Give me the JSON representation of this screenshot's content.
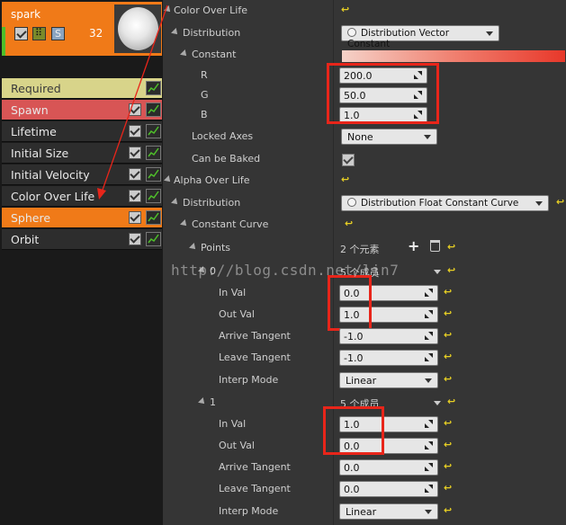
{
  "emitter": {
    "name": "spark",
    "solo": "S",
    "count": "32"
  },
  "modules": [
    {
      "label": "Required"
    },
    {
      "label": "Spawn"
    },
    {
      "label": "Lifetime"
    },
    {
      "label": "Initial Size"
    },
    {
      "label": "Initial Velocity"
    },
    {
      "label": "Color Over Life"
    },
    {
      "label": "Sphere"
    },
    {
      "label": "Orbit"
    }
  ],
  "details": {
    "color_over_life": "Color Over Life",
    "distribution": "Distribution",
    "distribution_vec": "Distribution Vector Constant",
    "constant": "Constant",
    "r_label": "R",
    "r_value": "200.0",
    "g_label": "G",
    "g_value": "50.0",
    "b_label": "B",
    "b_value": "1.0",
    "locked_axes": "Locked Axes",
    "locked_axes_value": "None",
    "can_be_baked": "Can be Baked",
    "alpha_over_life": "Alpha Over Life",
    "distribution2": "Distribution",
    "distribution_float": "Distribution Float Constant Curve",
    "constant_curve": "Constant Curve",
    "points": "Points",
    "points_count": "2 个元素",
    "p0_index": "0",
    "p0_members": "5 个成员",
    "p0_in_val_label": "In Val",
    "p0_in_val": "0.0",
    "p0_out_val_label": "Out Val",
    "p0_out_val": "1.0",
    "p0_arrive_label": "Arrive Tangent",
    "p0_arrive": "-1.0",
    "p0_leave_label": "Leave Tangent",
    "p0_leave": "-1.0",
    "p0_interp_label": "Interp Mode",
    "p0_interp": "Linear",
    "p1_index": "1",
    "p1_members": "5 个成员",
    "p1_in_val_label": "In Val",
    "p1_in_val": "1.0",
    "p1_out_val_label": "Out Val",
    "p1_out_val": "0.0",
    "p1_arrive_label": "Arrive Tangent",
    "p1_arrive": "0.0",
    "p1_leave_label": "Leave Tangent",
    "p1_leave": "0.0",
    "p1_interp_label": "Interp Mode",
    "p1_interp": "Linear"
  },
  "watermark": "http://blog.csdn.net/lin7",
  "colors": {
    "accent_orange": "#f07a18",
    "annotation_red": "#e8251a",
    "required_yellow": "#d8d48a",
    "spawn_red": "#d85555"
  }
}
